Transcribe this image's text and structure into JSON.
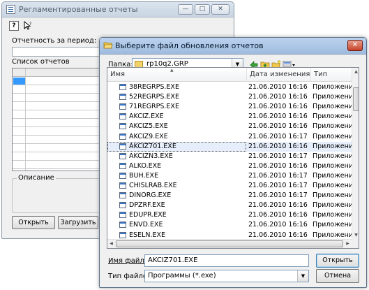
{
  "main_window": {
    "title": "Регламентированные отчеты",
    "period_label": "Отчетность за период:",
    "reports_label": "Список отчетов",
    "description_label": "Описание",
    "open_button": "Открыть",
    "load_button": "Загрузить",
    "controls": {
      "minimize": "—",
      "maximize": "□",
      "close": "✕"
    },
    "toolbar_icons": [
      "help-icon",
      "pointer-help-icon"
    ]
  },
  "dialog": {
    "title": "Выберите файл обновления отчетов",
    "folder_label": "Папка:",
    "folder_value": "rp10q2.GRP",
    "close_symbol": "✕",
    "columns": {
      "name": "Имя",
      "date": "Дата изменения",
      "type": "Тип"
    },
    "files": [
      {
        "name": "38REGRPS.EXE",
        "date": "21.06.2010 16:16",
        "type": "Приложение"
      },
      {
        "name": "52REGRPS.EXE",
        "date": "21.06.2010 16:16",
        "type": "Приложение"
      },
      {
        "name": "71REGRPS.EXE",
        "date": "21.06.2010 16:16",
        "type": "Приложение"
      },
      {
        "name": "AKCIZ.EXE",
        "date": "21.06.2010 16:16",
        "type": "Приложение"
      },
      {
        "name": "AKCIZ5.EXE",
        "date": "21.06.2010 16:16",
        "type": "Приложение"
      },
      {
        "name": "AKCIZ9.EXE",
        "date": "21.06.2010 16:17",
        "type": "Приложение"
      },
      {
        "name": "AKCIZ701.EXE",
        "date": "21.06.2010 16:16",
        "type": "Приложение",
        "selected": true
      },
      {
        "name": "AKCIZN3.EXE",
        "date": "21.06.2010 16:17",
        "type": "Приложение"
      },
      {
        "name": "ALKO.EXE",
        "date": "21.06.2010 16:16",
        "type": "Приложение"
      },
      {
        "name": "BUH.EXE",
        "date": "21.06.2010 16:17",
        "type": "Приложение"
      },
      {
        "name": "CHISLRAB.EXE",
        "date": "21.06.2010 16:17",
        "type": "Приложение"
      },
      {
        "name": "DINORG.EXE",
        "date": "21.06.2010 16:17",
        "type": "Приложение"
      },
      {
        "name": "DPZRF.EXE",
        "date": "21.06.2010 16:16",
        "type": "Приложение"
      },
      {
        "name": "EDUPR.EXE",
        "date": "21.06.2010 16:16",
        "type": "Приложение"
      },
      {
        "name": "ENVD.EXE",
        "date": "21.06.2010 16:16",
        "type": "Приложение"
      },
      {
        "name": "ESELN.EXE",
        "date": "21.06.2010 16:16",
        "type": "Приложение"
      }
    ],
    "filename_label": "Имя файла:",
    "filename_value": "AKCIZ701.EXE",
    "filetype_label": "Тип файлов:",
    "filetype_value": "Программы (*.exe)",
    "open_button": "Открыть",
    "cancel_button": "Отмена",
    "toolbar_icons": [
      "back-icon",
      "up-folder-icon",
      "new-folder-icon",
      "view-menu-icon"
    ]
  },
  "colors": {
    "selection": "#e5eefa",
    "title_active": "#9fbbde",
    "close_red": "#c8432a"
  }
}
